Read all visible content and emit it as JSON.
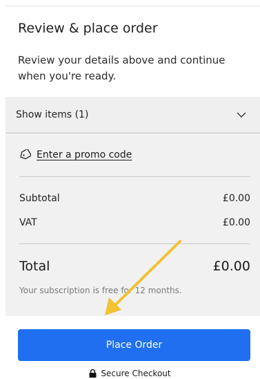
{
  "review": {
    "title": "Review & place order",
    "description": "Review your details above and continue when you're ready."
  },
  "items": {
    "toggle_label": "Show items (1)"
  },
  "promo": {
    "label": "Enter a promo code"
  },
  "summary": {
    "subtotal_label": "Subtotal",
    "subtotal_value": "£0.00",
    "vat_label": "VAT",
    "vat_value": "£0.00",
    "total_label": "Total",
    "total_value": "£0.00",
    "note": "Your subscription is free for 12 months."
  },
  "actions": {
    "place_order_label": "Place Order"
  },
  "footer": {
    "secure_label": "Secure Checkout"
  },
  "colors": {
    "accent": "#1f6ff0",
    "annotation_arrow": "#f1c232"
  },
  "icons": [
    "chevron-down-icon",
    "tag-icon",
    "lock-icon",
    "annotation-arrow"
  ]
}
